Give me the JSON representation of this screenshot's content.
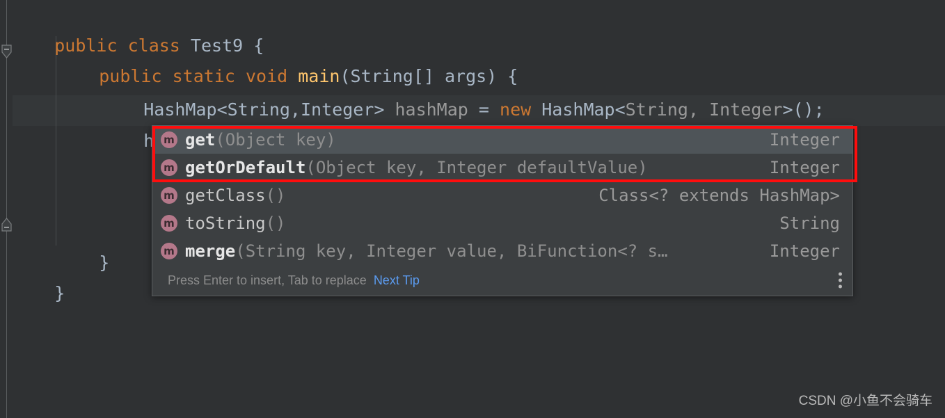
{
  "editor": {
    "theme_background": "#2f3133",
    "current_line_background": "#343739",
    "code_lines": [
      {
        "id": "line-1",
        "tokens": [
          {
            "text": "public",
            "kind": "keyword"
          },
          {
            "text": " ",
            "kind": "plain"
          },
          {
            "text": "class",
            "kind": "keyword"
          },
          {
            "text": " ",
            "kind": "plain"
          },
          {
            "text": "Test9",
            "kind": "type"
          },
          {
            "text": " {",
            "kind": "plain"
          }
        ],
        "plain": "public class Test9 {"
      },
      {
        "id": "line-2",
        "tokens": [
          {
            "text": "public",
            "kind": "keyword"
          },
          {
            "text": " ",
            "kind": "plain"
          },
          {
            "text": "static",
            "kind": "keyword"
          },
          {
            "text": " ",
            "kind": "plain"
          },
          {
            "text": "void",
            "kind": "keyword"
          },
          {
            "text": " ",
            "kind": "plain"
          },
          {
            "text": "main",
            "kind": "method"
          },
          {
            "text": "(String[] args) {",
            "kind": "plain"
          }
        ],
        "plain": "public static void main(String[] args) {"
      },
      {
        "id": "line-3",
        "tokens": [
          {
            "text": "HashMap<String,Integer>",
            "kind": "type"
          },
          {
            "text": " ",
            "kind": "plain"
          },
          {
            "text": "hashMap",
            "kind": "ident"
          },
          {
            "text": " ",
            "kind": "plain"
          },
          {
            "text": "=",
            "kind": "plain"
          },
          {
            "text": " ",
            "kind": "plain"
          },
          {
            "text": "new",
            "kind": "keyword"
          },
          {
            "text": " ",
            "kind": "plain"
          },
          {
            "text": "HashMap",
            "kind": "type"
          },
          {
            "text": "<",
            "kind": "plain"
          },
          {
            "text": "String, Integer",
            "kind": "ident"
          },
          {
            "text": ">();",
            "kind": "plain"
          }
        ],
        "plain": "HashMap<String,Integer> hashMap = new HashMap<String, Integer>();"
      },
      {
        "id": "line-4",
        "tokens": [
          {
            "text": "hashMap.g",
            "kind": "type"
          }
        ],
        "plain": "hashMap.g",
        "has_caret": true
      },
      {
        "id": "line-5",
        "tokens": [
          {
            "text": "}",
            "kind": "brace"
          }
        ],
        "plain": "}"
      },
      {
        "id": "line-6",
        "tokens": [
          {
            "text": "}",
            "kind": "brace"
          }
        ],
        "plain": "}"
      }
    ]
  },
  "completion_popup": {
    "items": [
      {
        "icon": "method-icon",
        "icon_letter": "m",
        "name": "get",
        "params": "(Object key)",
        "return_type": "Integer",
        "selected": true,
        "bold": true
      },
      {
        "icon": "method-icon",
        "icon_letter": "m",
        "name": "getOrDefault",
        "params": "(Object key, Integer defaultValue)",
        "return_type": "Integer",
        "selected": false,
        "bold": true
      },
      {
        "icon": "method-icon",
        "icon_letter": "m",
        "name": "getClass",
        "params": "()",
        "return_type": "Class<? extends HashMap>",
        "selected": false,
        "bold": false
      },
      {
        "icon": "method-icon",
        "icon_letter": "m",
        "name": "toString",
        "params": "()",
        "return_type": "String",
        "selected": false,
        "bold": false
      },
      {
        "icon": "method-icon",
        "icon_letter": "m",
        "name": "merge",
        "params": "(String key, Integer value, BiFunction<? s…",
        "return_type": "Integer",
        "selected": false,
        "bold": true
      }
    ],
    "hint": {
      "text": "Press Enter to insert, Tab to replace",
      "link_label": "Next Tip",
      "menu_icon": "kebab-menu-icon"
    }
  },
  "annotation": {
    "shape": "rectangle",
    "color": "#ff0d0d"
  },
  "watermark": {
    "text": "CSDN @小鱼不会骑车"
  }
}
